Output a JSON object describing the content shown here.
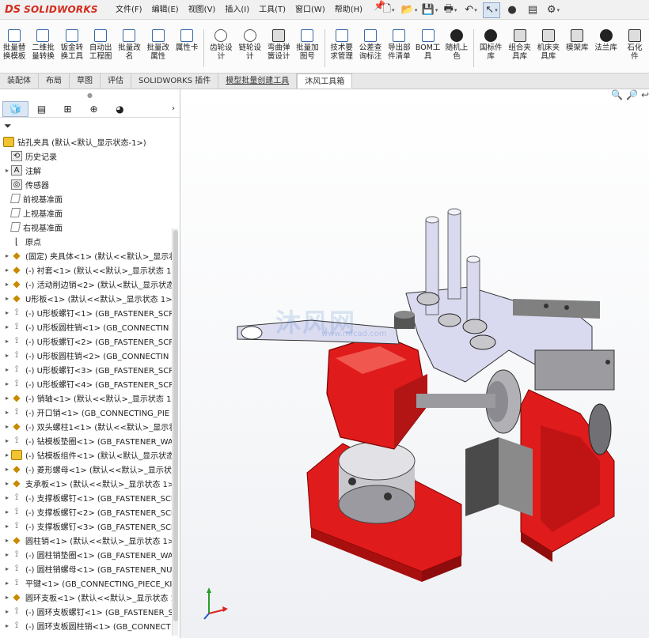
{
  "app": {
    "logo_ds": "DS",
    "logo_text": "SOLIDWORKS"
  },
  "menu": [
    {
      "label": "文件(F)"
    },
    {
      "label": "编辑(E)"
    },
    {
      "label": "视图(V)"
    },
    {
      "label": "插入(I)"
    },
    {
      "label": "工具(T)"
    },
    {
      "label": "窗口(W)"
    },
    {
      "label": "帮助(H)"
    }
  ],
  "ribbon": {
    "groups": [
      [
        {
          "label": "批量替\n换模板",
          "icon": "template-replace-icon"
        },
        {
          "label": "二维批\n量转换",
          "icon": "batch-convert-icon"
        },
        {
          "label": "钣金转\n换工具",
          "icon": "sheetmetal-convert-icon"
        },
        {
          "label": "自动出\n工程图",
          "icon": "auto-drawing-icon"
        },
        {
          "label": "批量改\n名",
          "icon": "batch-rename-icon"
        },
        {
          "label": "批量改\n属性",
          "icon": "batch-property-icon"
        },
        {
          "label": "属性卡",
          "icon": "property-card-icon"
        }
      ],
      [
        {
          "label": "齿轮设\n计",
          "icon": "gear-design-icon"
        },
        {
          "label": "链轮设\n计",
          "icon": "sprocket-design-icon"
        },
        {
          "label": "弯曲弹\n簧设计",
          "icon": "spring-design-icon"
        },
        {
          "label": "批量加\n图号",
          "icon": "drawing-number-icon"
        }
      ],
      [
        {
          "label": "技术要\n求管理",
          "icon": "tech-requirement-icon"
        },
        {
          "label": "公差查\n询标注",
          "icon": "tolerance-icon"
        },
        {
          "label": "导出部\n件清单",
          "icon": "export-bom-icon"
        },
        {
          "label": "BOM工\n具",
          "icon": "bom-tool-icon"
        },
        {
          "label": "随机上\n色",
          "icon": "random-color-icon"
        }
      ],
      [
        {
          "label": "国标件\n库",
          "icon": "gb-library-icon"
        },
        {
          "label": "组合夹\n具库",
          "icon": "fixture-library-icon"
        },
        {
          "label": "机床夹\n具库",
          "icon": "machine-fixture-icon"
        },
        {
          "label": "模架库",
          "icon": "mold-base-icon"
        },
        {
          "label": "法兰库",
          "icon": "flange-library-icon"
        },
        {
          "label": "石化\n件",
          "icon": "petrochem-icon"
        }
      ]
    ]
  },
  "tabs": [
    {
      "label": "装配体",
      "active": false
    },
    {
      "label": "布局",
      "active": false
    },
    {
      "label": "草图",
      "active": false
    },
    {
      "label": "评估",
      "active": false
    },
    {
      "label": "SOLIDWORKS 插件",
      "active": false
    },
    {
      "label": "模型批量创建工具",
      "active": false
    },
    {
      "label": "沐风工具箱",
      "active": true
    }
  ],
  "tree": {
    "root": "钻孔夹具 (默认<默认_显示状态-1>)",
    "items": [
      {
        "label": "历史记录",
        "icon": "history-icon",
        "expand": false
      },
      {
        "label": "注解",
        "icon": "annotation-icon",
        "expand": true
      },
      {
        "label": "传感器",
        "icon": "sensor-icon",
        "expand": false
      },
      {
        "label": "前视基准面",
        "icon": "plane-icon",
        "expand": false
      },
      {
        "label": "上视基准面",
        "icon": "plane-icon",
        "expand": false
      },
      {
        "label": "右视基准面",
        "icon": "plane-icon",
        "expand": false
      },
      {
        "label": "原点",
        "icon": "origin-icon",
        "expand": false
      },
      {
        "label": "(固定) 夹具体<1> (默认<<默认>_显示状",
        "icon": "part-icon",
        "expand": true
      },
      {
        "label": "(-) 衬套<1> (默认<<默认>_显示状态 1",
        "icon": "part-icon",
        "expand": true
      },
      {
        "label": "(-) 活动削边销<2> (默认<默认_显示状态",
        "icon": "part-icon",
        "expand": true
      },
      {
        "label": "U形板<1> (默认<<默认>_显示状态 1>",
        "icon": "part-icon",
        "expand": true
      },
      {
        "label": "(-) U形板螺钉<1> (GB_FASTENER_SCR",
        "icon": "screw-icon",
        "expand": true
      },
      {
        "label": "(-) U形板圆柱销<1> (GB_CONNECTIN",
        "icon": "screw-icon",
        "expand": true
      },
      {
        "label": "(-) U形板螺钉<2> (GB_FASTENER_SCR",
        "icon": "screw-icon",
        "expand": true
      },
      {
        "label": "(-) U形板圆柱销<2> (GB_CONNECTIN",
        "icon": "screw-icon",
        "expand": true
      },
      {
        "label": "(-) U形板螺钉<3> (GB_FASTENER_SCR",
        "icon": "screw-icon",
        "expand": true
      },
      {
        "label": "(-) U形板螺钉<4> (GB_FASTENER_SCR",
        "icon": "screw-icon",
        "expand": true
      },
      {
        "label": "(-) 销轴<1> (默认<<默认>_显示状态 1",
        "icon": "part-icon",
        "expand": true
      },
      {
        "label": "(-) 开口销<1> (GB_CONNECTING_PIE",
        "icon": "screw-icon",
        "expand": true
      },
      {
        "label": "(-) 双头螺柱1<1> (默认<<默认>_显示状",
        "icon": "part-icon",
        "expand": true
      },
      {
        "label": "(-) 钻模板垫圈<1> (GB_FASTENER_WA",
        "icon": "screw-icon",
        "expand": true
      },
      {
        "label": "(-) 钻模板组件<1> (默认<默认_显示状态",
        "icon": "assembly-icon",
        "expand": true
      },
      {
        "label": "(-) 菱形螺母<1> (默认<<默认>_显示状",
        "icon": "part-icon",
        "expand": true
      },
      {
        "label": "支承板<1> (默认<<默认>_显示状态 1>",
        "icon": "part-icon",
        "expand": true
      },
      {
        "label": "(-) 支撑板螺钉<1> (GB_FASTENER_SCI",
        "icon": "screw-icon",
        "expand": true
      },
      {
        "label": "(-) 支撑板螺钉<2> (GB_FASTENER_SCI",
        "icon": "screw-icon",
        "expand": true
      },
      {
        "label": "(-) 支撑板螺钉<3> (GB_FASTENER_SCI",
        "icon": "screw-icon",
        "expand": true
      },
      {
        "label": "圆柱销<1> (默认<<默认>_显示状态 1>",
        "icon": "part-icon",
        "expand": true
      },
      {
        "label": "(-) 圆柱销垫圈<1> (GB_FASTENER_WA",
        "icon": "screw-icon",
        "expand": true
      },
      {
        "label": "(-) 圆柱销螺母<1> (GB_FASTENER_NU",
        "icon": "screw-icon",
        "expand": true
      },
      {
        "label": "平键<1> (GB_CONNECTING_PIECE_KI",
        "icon": "screw-icon",
        "expand": true
      },
      {
        "label": "圆环支板<1> (默认<<默认>_显示状态 1",
        "icon": "part-icon",
        "expand": true
      },
      {
        "label": "(-) 圆环支板螺钉<1> (GB_FASTENER_S",
        "icon": "screw-icon",
        "expand": true
      },
      {
        "label": "(-) 圆环支板圆柱销<1> (GB_CONNECT",
        "icon": "screw-icon",
        "expand": true
      }
    ]
  },
  "viewport": {
    "watermark": "沐风网",
    "watermark_url": "www.mfcad.com"
  },
  "colors": {
    "accent_red": "#d52b1e",
    "base_red": "#e01b1b",
    "steel": "#c8c8cc",
    "plate": "#d9d9f0"
  }
}
